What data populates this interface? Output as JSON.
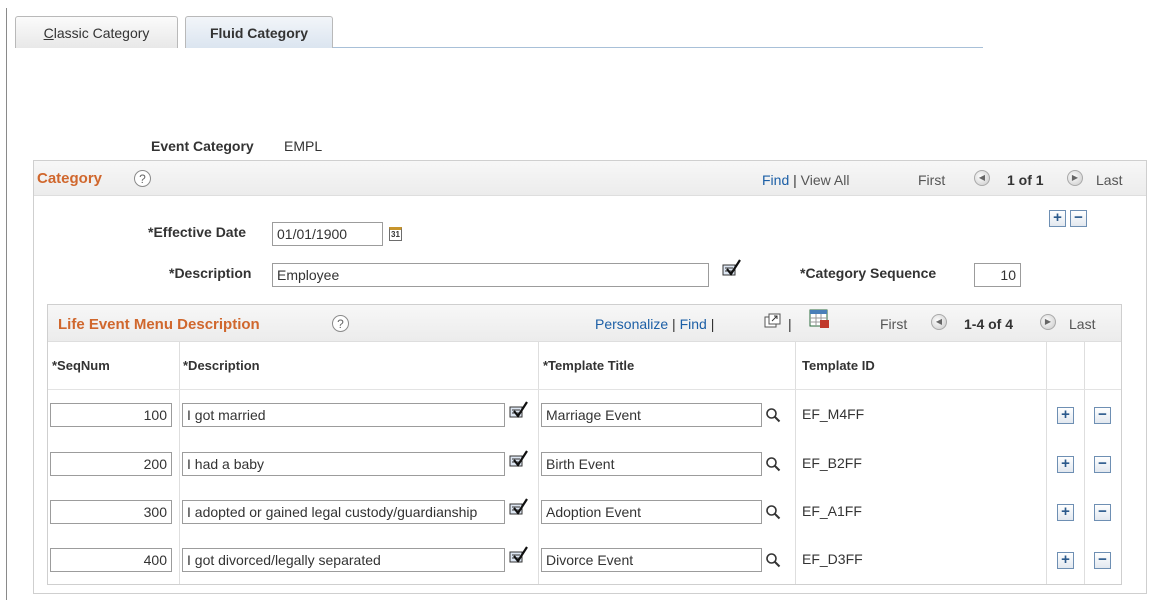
{
  "tabs": [
    {
      "label": "Classic Category",
      "access_key": "C",
      "rest": "lassic Category",
      "active": false
    },
    {
      "label": "Fluid Category",
      "active": true
    }
  ],
  "event_category": {
    "label": "Event Category",
    "value": "EMPL"
  },
  "category_section": {
    "title": "Category",
    "find_label": "Find",
    "view_all_label": "View All",
    "first_label": "First",
    "page_info": "1 of 1",
    "last_label": "Last",
    "effective_date": {
      "label": "*Effective Date",
      "value": "01/01/1900"
    },
    "description": {
      "label": "*Description",
      "value": "Employee"
    },
    "category_sequence": {
      "label": "*Category Sequence",
      "value": "10"
    }
  },
  "life_event_grid": {
    "title": "Life Event Menu Description",
    "personalize_label": "Personalize",
    "find_label": "Find",
    "first_label": "First",
    "page_info": "1-4 of 4",
    "last_label": "Last",
    "columns": [
      "*SeqNum",
      "*Description",
      "*Template Title",
      "Template ID"
    ],
    "rows": [
      {
        "seqnum": "100",
        "description": "I got married",
        "template_title": "Marriage Event",
        "template_id": "EF_M4FF"
      },
      {
        "seqnum": "200",
        "description": "I had a baby",
        "template_title": "Birth Event",
        "template_id": "EF_B2FF"
      },
      {
        "seqnum": "300",
        "description": "I adopted or gained legal custody/guardianship",
        "template_title": "Adoption Event",
        "template_id": "EF_A1FF"
      },
      {
        "seqnum": "400",
        "description": "I got divorced/legally separated",
        "template_title": "Divorce Event",
        "template_id": "EF_D3FF"
      }
    ]
  },
  "icons": {
    "help": "help-icon",
    "calendar": "calendar-icon",
    "spellcheck": "spell-check-icon",
    "lookup": "lookup-icon",
    "prev": "previous-arrow-icon",
    "next": "next-arrow-icon",
    "zoom": "zoom-icon",
    "download": "download-to-excel-icon"
  },
  "colors": {
    "section_title": "#d0672d",
    "link": "#1c5fa6",
    "button_border": "#6e8fb3"
  }
}
